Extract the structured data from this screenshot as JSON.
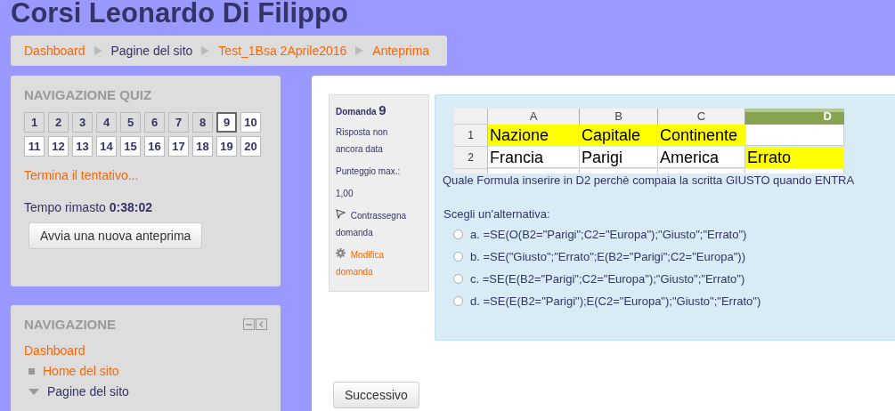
{
  "site_title": "Corsi Leonardo Di Filippo",
  "breadcrumb": [
    {
      "label": "Dashboard",
      "link": true
    },
    {
      "label": "Pagine del sito",
      "link": false
    },
    {
      "label": "Test_1Bsa 2Aprile2016",
      "link": true
    },
    {
      "label": "Anteprima",
      "link": true
    }
  ],
  "quiz_navigation": {
    "title": "NAVIGAZIONE QUIZ",
    "questions": [
      {
        "label": "1",
        "answered": true,
        "selected": false
      },
      {
        "label": "2",
        "answered": true,
        "selected": false
      },
      {
        "label": "3",
        "answered": true,
        "selected": false
      },
      {
        "label": "4",
        "answered": true,
        "selected": false
      },
      {
        "label": "5",
        "answered": true,
        "selected": false
      },
      {
        "label": "6",
        "answered": true,
        "selected": false
      },
      {
        "label": "7",
        "answered": true,
        "selected": false
      },
      {
        "label": "8",
        "answered": true,
        "selected": false
      },
      {
        "label": "9",
        "answered": false,
        "selected": true
      },
      {
        "label": "10",
        "answered": false,
        "selected": false
      },
      {
        "label": "11",
        "answered": false,
        "selected": false
      },
      {
        "label": "12",
        "answered": false,
        "selected": false
      },
      {
        "label": "13",
        "answered": false,
        "selected": false
      },
      {
        "label": "14",
        "answered": false,
        "selected": false
      },
      {
        "label": "15",
        "answered": false,
        "selected": false
      },
      {
        "label": "16",
        "answered": false,
        "selected": false
      },
      {
        "label": "17",
        "answered": false,
        "selected": false
      },
      {
        "label": "18",
        "answered": false,
        "selected": false
      },
      {
        "label": "19",
        "answered": false,
        "selected": false
      },
      {
        "label": "20",
        "answered": false,
        "selected": false
      }
    ],
    "finish_link": "Termina il tentativo...",
    "time_label": "Tempo rimasto",
    "time_value": "0:38:02",
    "restart_button": "Avvia una nuova anteprima"
  },
  "navigation": {
    "title": "NAVIGAZIONE",
    "items": [
      {
        "label": "Dashboard",
        "kind": "link"
      },
      {
        "label": "Home del sito",
        "kind": "leaf"
      },
      {
        "label": "Pagine del sito",
        "kind": "branch",
        "expanded": true
      }
    ]
  },
  "question_info": {
    "label": "Domanda",
    "number": "9",
    "status": "Risposta non ancora data",
    "max_score_label": "Punteggio max.:",
    "max_score": "1,00",
    "flag_link": "Contrassegna domanda",
    "edit_link": "Modifica domanda"
  },
  "spreadsheet": {
    "columns": [
      {
        "label": "A",
        "selected": false
      },
      {
        "label": "B",
        "selected": false
      },
      {
        "label": "C",
        "selected": false
      },
      {
        "label": "D",
        "selected": true
      }
    ],
    "rows": [
      {
        "number": "1",
        "cells": [
          {
            "text": "Nazione",
            "highlight": true
          },
          {
            "text": "Capitale",
            "highlight": true
          },
          {
            "text": "Continente",
            "highlight": true
          },
          {
            "text": "",
            "highlight": false
          }
        ]
      },
      {
        "number": "2",
        "cells": [
          {
            "text": "Francia",
            "highlight": false
          },
          {
            "text": "Parigi",
            "highlight": false
          },
          {
            "text": "America",
            "highlight": false
          },
          {
            "text": "Errato",
            "highlight": true
          }
        ]
      }
    ]
  },
  "question_text": "Quale Formula inserire in D2 perchè compaia la scritta GIUSTO quando ENTRA",
  "prompt": "Scegli un'alternativa:",
  "options": [
    {
      "text": "a. =SE(O(B2=\"Parigi\";C2=\"Europa\");\"Giusto\";\"Errato\")",
      "selected": false
    },
    {
      "text": "b. =SE(\"Giusto\";\"Errato\";E(B2=\"Parigi\";C2=\"Europa\"))",
      "selected": false
    },
    {
      "text": "c. =SE(E(B2=\"Parigi\";C2=\"Europa\");\"Giusto\";\"Errato\")",
      "selected": false
    },
    {
      "text": "d. =SE(E(B2=\"Parigi\");E(C2=\"Europa\");\"Giusto\";\"Errato\")",
      "selected": false
    }
  ],
  "next_button": "Successivo"
}
